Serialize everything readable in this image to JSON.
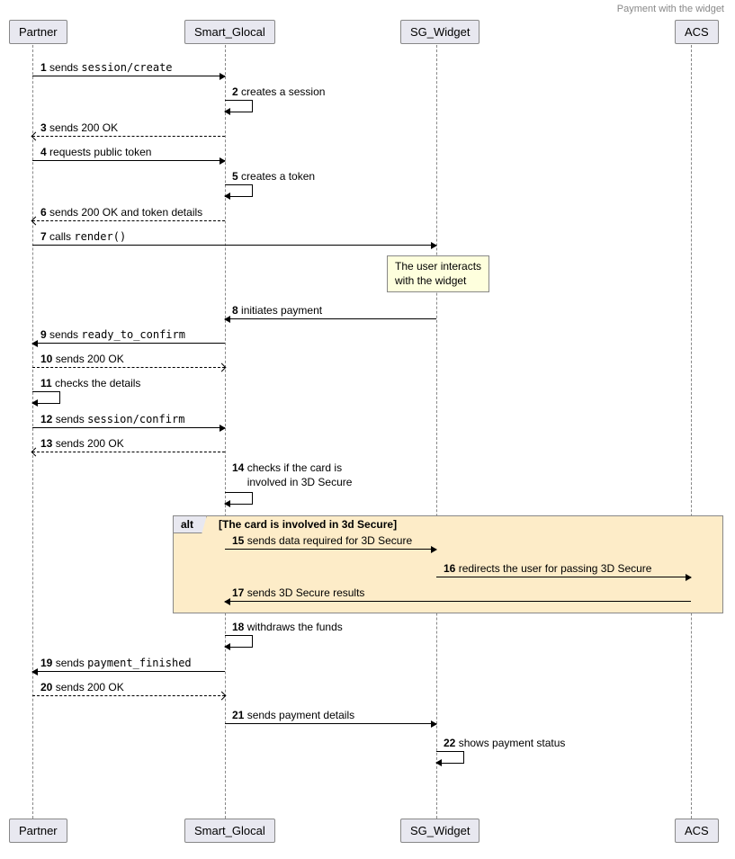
{
  "title": "Payment with the widget",
  "participants": [
    "Partner",
    "Smart_Glocal",
    "SG_Widget",
    "ACS"
  ],
  "alt": {
    "label": "alt",
    "condition": "[The card is involved in 3d Secure]"
  },
  "note": {
    "line1": "The user interacts",
    "line2": "with the widget"
  },
  "messages": {
    "m1": {
      "n": "1",
      "text": "sends ",
      "code": "session/create"
    },
    "m2": {
      "n": "2",
      "text": "creates a session"
    },
    "m3": {
      "n": "3",
      "text": "sends 200 OK"
    },
    "m4": {
      "n": "4",
      "text": "requests public token"
    },
    "m5": {
      "n": "5",
      "text": "creates a token"
    },
    "m6": {
      "n": "6",
      "text": "sends 200 OK and token details"
    },
    "m7": {
      "n": "7",
      "text": "calls ",
      "code": "render()"
    },
    "m8": {
      "n": "8",
      "text": "initiates payment"
    },
    "m9": {
      "n": "9",
      "text": "sends ",
      "code": "ready_to_confirm"
    },
    "m10": {
      "n": "10",
      "text": "sends 200 OK"
    },
    "m11": {
      "n": "11",
      "text": "checks the details"
    },
    "m12": {
      "n": "12",
      "text": "sends ",
      "code": "session/confirm"
    },
    "m13": {
      "n": "13",
      "text": "sends 200 OK"
    },
    "m14": {
      "n": "14",
      "line1": "checks if the card is",
      "line2": "involved in 3D Secure"
    },
    "m15": {
      "n": "15",
      "text": "sends data required for 3D Secure"
    },
    "m16": {
      "n": "16",
      "text": "redirects the user for passing 3D Secure"
    },
    "m17": {
      "n": "17",
      "text": "sends 3D Secure results"
    },
    "m18": {
      "n": "18",
      "text": "withdraws the funds"
    },
    "m19": {
      "n": "19",
      "text": "sends ",
      "code": "payment_finished"
    },
    "m20": {
      "n": "20",
      "text": "sends 200 OK"
    },
    "m21": {
      "n": "21",
      "text": "sends payment details"
    },
    "m22": {
      "n": "22",
      "text": "shows payment status"
    }
  },
  "chart_data": {
    "type": "sequence-diagram",
    "participants": [
      "Partner",
      "Smart_Glocal",
      "SG_Widget",
      "ACS"
    ],
    "messages": [
      {
        "n": 1,
        "from": "Partner",
        "to": "Smart_Glocal",
        "label": "sends session/create",
        "style": "solid"
      },
      {
        "n": 2,
        "from": "Smart_Glocal",
        "to": "Smart_Glocal",
        "label": "creates a session",
        "style": "self"
      },
      {
        "n": 3,
        "from": "Smart_Glocal",
        "to": "Partner",
        "label": "sends 200 OK",
        "style": "dashed"
      },
      {
        "n": 4,
        "from": "Partner",
        "to": "Smart_Glocal",
        "label": "requests public token",
        "style": "solid"
      },
      {
        "n": 5,
        "from": "Smart_Glocal",
        "to": "Smart_Glocal",
        "label": "creates a token",
        "style": "self"
      },
      {
        "n": 6,
        "from": "Smart_Glocal",
        "to": "Partner",
        "label": "sends 200 OK and token details",
        "style": "dashed"
      },
      {
        "n": 7,
        "from": "Partner",
        "to": "SG_Widget",
        "label": "calls render()",
        "style": "solid"
      },
      {
        "note": "The user interacts with the widget",
        "over": "SG_Widget"
      },
      {
        "n": 8,
        "from": "SG_Widget",
        "to": "Smart_Glocal",
        "label": "initiates payment",
        "style": "solid"
      },
      {
        "n": 9,
        "from": "Smart_Glocal",
        "to": "Partner",
        "label": "sends ready_to_confirm",
        "style": "solid"
      },
      {
        "n": 10,
        "from": "Partner",
        "to": "Smart_Glocal",
        "label": "sends 200 OK",
        "style": "dashed"
      },
      {
        "n": 11,
        "from": "Partner",
        "to": "Partner",
        "label": "checks the details",
        "style": "self"
      },
      {
        "n": 12,
        "from": "Partner",
        "to": "Smart_Glocal",
        "label": "sends session/confirm",
        "style": "solid"
      },
      {
        "n": 13,
        "from": "Smart_Glocal",
        "to": "Partner",
        "label": "sends 200 OK",
        "style": "dashed"
      },
      {
        "n": 14,
        "from": "Smart_Glocal",
        "to": "Smart_Glocal",
        "label": "checks if the card is involved in 3D Secure",
        "style": "self"
      },
      {
        "alt": "[The card is involved in 3d Secure]",
        "messages": [
          {
            "n": 15,
            "from": "Smart_Glocal",
            "to": "SG_Widget",
            "label": "sends data required for 3D Secure",
            "style": "solid"
          },
          {
            "n": 16,
            "from": "SG_Widget",
            "to": "ACS",
            "label": "redirects the user for passing 3D Secure",
            "style": "solid"
          },
          {
            "n": 17,
            "from": "ACS",
            "to": "Smart_Glocal",
            "label": "sends 3D Secure results",
            "style": "solid"
          }
        ]
      },
      {
        "n": 18,
        "from": "Smart_Glocal",
        "to": "Smart_Glocal",
        "label": "withdraws the funds",
        "style": "self"
      },
      {
        "n": 19,
        "from": "Smart_Glocal",
        "to": "Partner",
        "label": "sends payment_finished",
        "style": "solid"
      },
      {
        "n": 20,
        "from": "Partner",
        "to": "Smart_Glocal",
        "label": "sends 200 OK",
        "style": "dashed"
      },
      {
        "n": 21,
        "from": "Smart_Glocal",
        "to": "SG_Widget",
        "label": "sends payment details",
        "style": "solid"
      },
      {
        "n": 22,
        "from": "SG_Widget",
        "to": "SG_Widget",
        "label": "shows payment status",
        "style": "self"
      }
    ]
  }
}
